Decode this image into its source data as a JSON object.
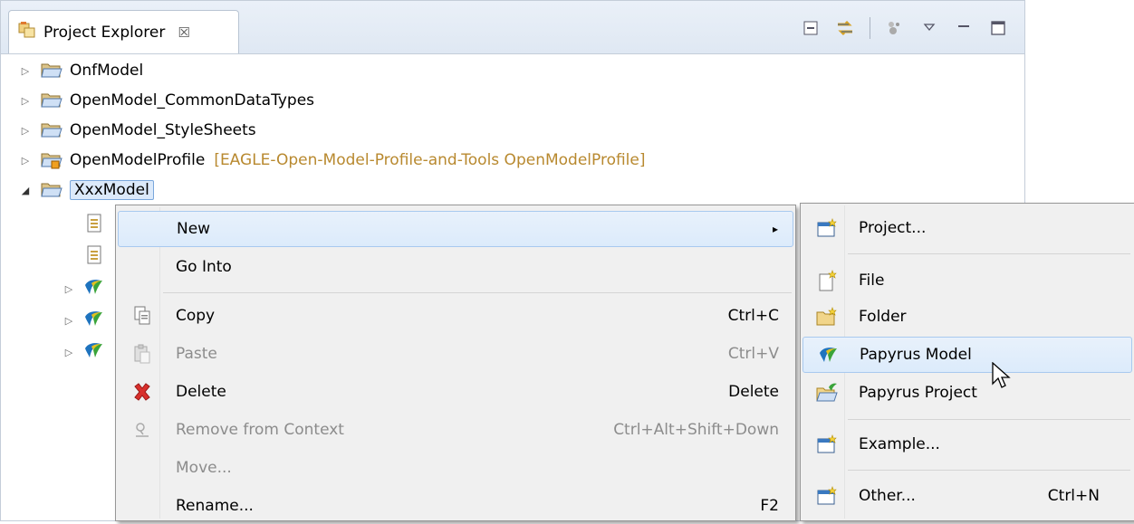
{
  "view": {
    "title": "Project Explorer",
    "close_glyph": "☒",
    "toolbar": [
      "collapse-all-icon",
      "link-with-editor-icon",
      "filters-icon",
      "view-menu-icon",
      "minimize-icon",
      "maximize-icon"
    ]
  },
  "tree": {
    "items": [
      {
        "label": "OnfModel",
        "twisty": "▷",
        "icon": "folder-icon"
      },
      {
        "label": "OpenModel_CommonDataTypes",
        "twisty": "▷",
        "icon": "folder-icon"
      },
      {
        "label": "OpenModel_StyleSheets",
        "twisty": "▷",
        "icon": "folder-icon"
      },
      {
        "label": "OpenModelProfile",
        "decoration": "[EAGLE-Open-Model-Profile-and-Tools OpenModelProfile]",
        "twisty": "▷",
        "icon": "git-folder-icon"
      },
      {
        "label": "XxxModel",
        "twisty": "◢",
        "icon": "folder-icon",
        "selected": true
      }
    ],
    "children_twisty": "▷"
  },
  "context_menu": {
    "items": [
      {
        "label": "New",
        "shortcut": "",
        "arrow": "▸",
        "enabled": true,
        "highlighted": true
      },
      {
        "label": "Go Into",
        "shortcut": "",
        "enabled": true
      },
      {
        "label": "Copy",
        "shortcut": "Ctrl+C",
        "icon": "copy-icon",
        "enabled": true
      },
      {
        "label": "Paste",
        "shortcut": "Ctrl+V",
        "icon": "paste-icon",
        "enabled": false
      },
      {
        "label": "Delete",
        "shortcut": "Delete",
        "icon": "delete-icon",
        "enabled": true
      },
      {
        "label": "Remove from Context",
        "shortcut": "Ctrl+Alt+Shift+Down",
        "icon": "remove-context-icon",
        "enabled": false
      },
      {
        "label": "Move...",
        "shortcut": "",
        "enabled": false
      },
      {
        "label": "Rename...",
        "shortcut": "F2",
        "enabled": true
      }
    ]
  },
  "submenu": {
    "items": [
      {
        "label": "Project...",
        "shortcut": "",
        "icon": "new-project-icon"
      },
      {
        "label": "File",
        "shortcut": "",
        "icon": "new-file-icon"
      },
      {
        "label": "Folder",
        "shortcut": "",
        "icon": "new-folder-icon"
      },
      {
        "label": "Papyrus Model",
        "shortcut": "",
        "icon": "papyrus-icon",
        "highlighted": true
      },
      {
        "label": "Papyrus Project",
        "shortcut": "",
        "icon": "papyrus-project-icon"
      },
      {
        "label": "Example...",
        "shortcut": "",
        "icon": "new-example-icon"
      },
      {
        "label": "Other...",
        "shortcut": "Ctrl+N",
        "icon": "new-other-icon"
      }
    ]
  },
  "colors": {
    "accent": "#7aa7dc",
    "decoration": "#b8892f",
    "delete_icon": "#d9302c",
    "papyrus_green": "#3aa43a",
    "papyrus_yellow": "#e3c020",
    "papyrus_blue": "#1e73be"
  }
}
